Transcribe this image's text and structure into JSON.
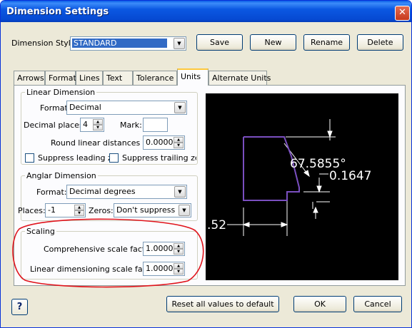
{
  "window": {
    "title": "Dimension Settings",
    "close_glyph": "✕"
  },
  "style_row": {
    "label": "Dimension Style:",
    "value": "STANDARD",
    "buttons": {
      "save": "Save",
      "new": "New",
      "rename": "Rename",
      "delete": "Delete"
    }
  },
  "tabs": [
    "Arrows",
    "Format",
    "Lines",
    "Text",
    "Tolerance",
    "Units",
    "Alternate Units"
  ],
  "active_tab": "Units",
  "linear": {
    "title": "Linear Dimension",
    "format_label": "Format:",
    "format_value": "Decimal",
    "decimal_places_label": "Decimal places:",
    "decimal_places_value": "4",
    "mark_label": "Mark:",
    "mark_value": "",
    "round_label": "Round linear distances to:",
    "round_value": "0.0000",
    "suppress_leading": "Suppress leading zero",
    "suppress_trailing": "Suppress trailing zeros"
  },
  "angular": {
    "title": "Anglar Dimension",
    "format_label": "Format:",
    "format_value": "Decimal degrees",
    "places_label": "Places:",
    "places_value": "-1",
    "zeros_label": "Zeros:",
    "zeros_value": "Don't suppress"
  },
  "scaling": {
    "title": "Scaling",
    "comprehensive_label": "Comprehensive scale factor:",
    "comprehensive_value": "1.0000",
    "linear_label": "Linear dimensioning scale factor:",
    "linear_value": "1.0000"
  },
  "preview": {
    "angle_text": "67.5855°",
    "tol_text": "0.1647",
    "dim_text": ".52"
  },
  "footer": {
    "help_label": "?",
    "reset_label": "Reset all values to default",
    "ok_label": "OK",
    "cancel_label": "Cancel"
  },
  "colors": {
    "annotation_circle": "#e0141c",
    "preview_shape": "#7a4fc0",
    "preview_lines": "#ffffff"
  }
}
